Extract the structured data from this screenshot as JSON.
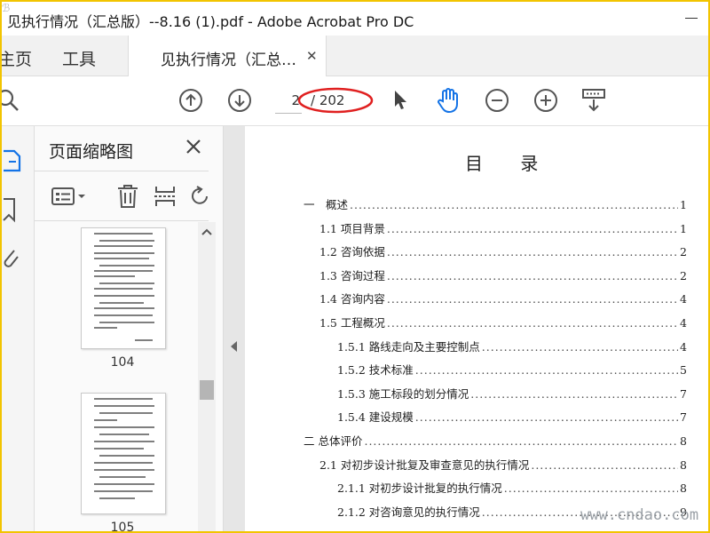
{
  "window": {
    "title": "见执行情况（汇总版）--8.16 (1).pdf - Adobe Acrobat Pro DC"
  },
  "tabs": {
    "home": "主页",
    "tools": "工具",
    "document": "见执行情况（汇总…"
  },
  "toolbar": {
    "page_current": "2",
    "page_total": "/ 202"
  },
  "thumbnails": {
    "title": "页面缩略图",
    "pages": [
      {
        "label": "104"
      },
      {
        "label": "105"
      }
    ]
  },
  "document": {
    "toc_title": "目 录",
    "toc": [
      {
        "text": "一　概述",
        "page": "1",
        "level": 0
      },
      {
        "text": "1.1 项目背景",
        "page": "1",
        "level": 1
      },
      {
        "text": "1.2 咨询依据",
        "page": "2",
        "level": 1
      },
      {
        "text": "1.3 咨询过程",
        "page": "2",
        "level": 1
      },
      {
        "text": "1.4 咨询内容",
        "page": "4",
        "level": 1
      },
      {
        "text": "1.5 工程概况",
        "page": "4",
        "level": 1
      },
      {
        "text": "1.5.1 路线走向及主要控制点",
        "page": "4",
        "level": 2
      },
      {
        "text": "1.5.2 技术标准",
        "page": "5",
        "level": 2
      },
      {
        "text": "1.5.3 施工标段的划分情况",
        "page": "7",
        "level": 2
      },
      {
        "text": "1.5.4 建设规模",
        "page": "7",
        "level": 2
      },
      {
        "text": "二 总体评价",
        "page": "8",
        "level": 0
      },
      {
        "text": "2.1 对初步设计批复及审查意见的执行情况",
        "page": "8",
        "level": 1
      },
      {
        "text": "2.1.1 对初步设计批复的执行情况",
        "page": "8",
        "level": 2
      },
      {
        "text": "2.1.2 对咨询意见的执行情况",
        "page": "9",
        "level": 2
      }
    ],
    "watermark": "www.cndao.com"
  },
  "colors": {
    "accent_blue": "#1473e6",
    "annotation_red": "#e02020",
    "frame_yellow": "#f2c400"
  }
}
